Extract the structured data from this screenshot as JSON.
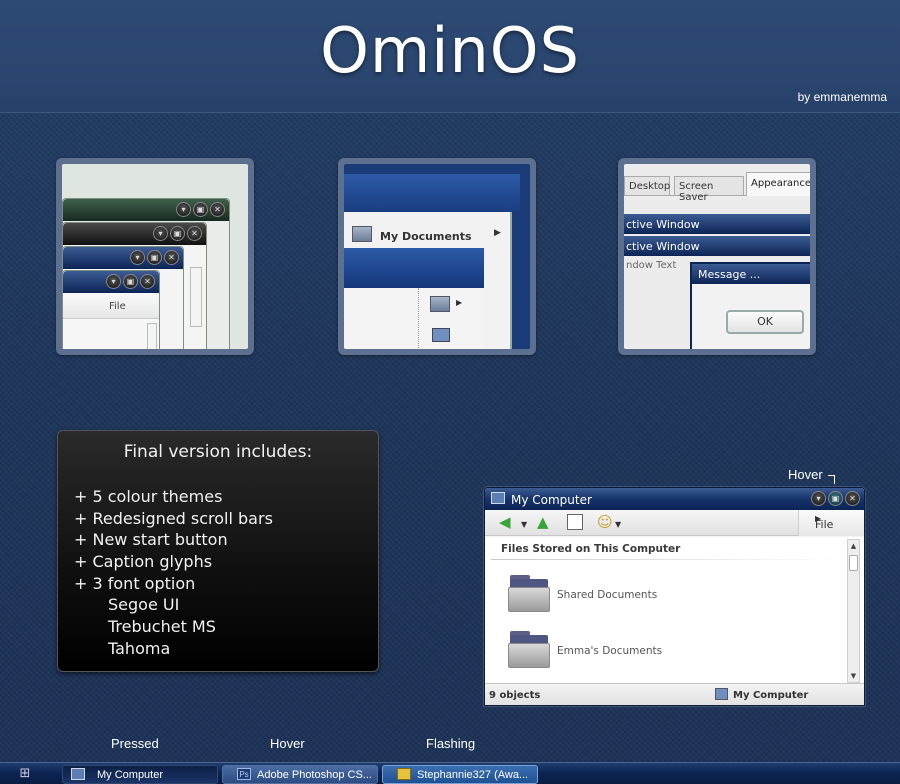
{
  "header": {
    "title": "OminOS",
    "byline": "by emmanemma"
  },
  "previews": {
    "stack": {
      "file_label": "File"
    },
    "documents": {
      "item_label": "My Documents"
    },
    "appearance": {
      "tabs": [
        "Desktop",
        "Screen Saver",
        "Appearance"
      ],
      "rows": [
        "ctive Window",
        "ctive Window",
        "ndow Text"
      ],
      "dialog_title": "Message ...",
      "ok_label": "OK"
    }
  },
  "features": {
    "title": "Final version includes:",
    "items": [
      "+ 5 colour themes",
      "+ Redesigned scroll bars",
      "+ New start button",
      "+ Caption glyphs",
      "+ 3 font option"
    ],
    "fonts": [
      "Segoe UI",
      "Trebuchet MS",
      "Tahoma"
    ]
  },
  "explorer": {
    "hover_label": "Hover",
    "title": "My Computer",
    "file_menu": "File",
    "section_title": "Files Stored on This Computer",
    "items": [
      "Shared Documents",
      "Emma's Documents"
    ],
    "status_count": "9 objects",
    "status_location": "My Computer"
  },
  "taskbar": {
    "state_labels": {
      "pressed": "Pressed",
      "hover": "Hover",
      "flashing": "Flashing"
    },
    "tasks": [
      {
        "label": "My Computer",
        "state": "pressed"
      },
      {
        "label": "Adobe Photoshop CS...",
        "state": "hover"
      },
      {
        "label": "Stephannie327 (Awa...",
        "state": "flashing"
      }
    ]
  }
}
